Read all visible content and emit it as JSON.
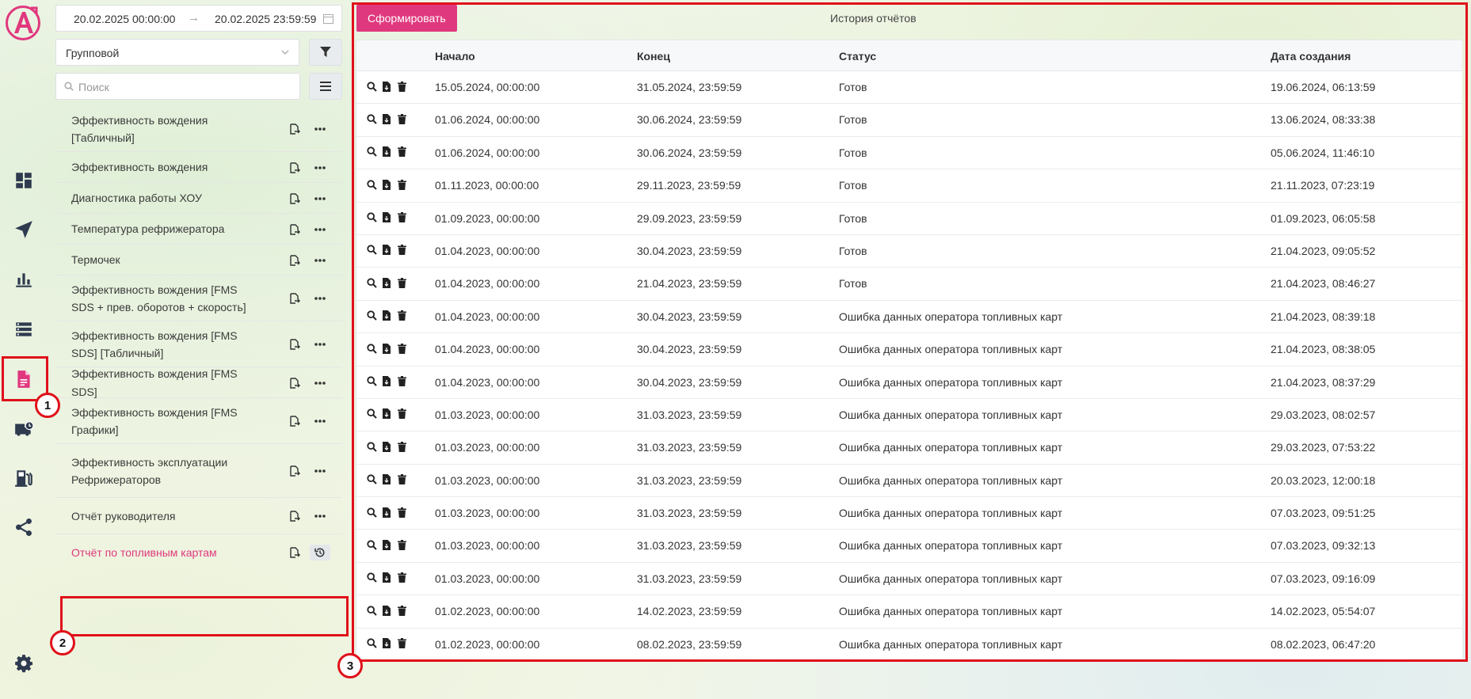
{
  "sidebar": {
    "date_start": "20.02.2025 00:00:00",
    "date_end": "20.02.2025 23:59:59",
    "report_type": "Групповой",
    "search_placeholder": "Поиск",
    "reports": [
      {
        "label": "Эффективность вождения [Табличный]"
      },
      {
        "label": "Эффективность вождения"
      },
      {
        "label": "Диагностика работы ХОУ"
      },
      {
        "label": "Температура рефрижератора"
      },
      {
        "label": "Термочек"
      },
      {
        "label": "Эффективность вождения [FMS SDS + прев. оборотов + скорость]"
      },
      {
        "label": "Эффективность вождения [FMS SDS] [Табличный]"
      },
      {
        "label": "Эффективность вождения [FMS SDS]"
      },
      {
        "label": "Эффективность вождения [FMS Графики]"
      },
      {
        "label": "Эффективность эксплуатации Рефрижераторов"
      },
      {
        "label": "Отчёт руководителя"
      },
      {
        "label": "Отчёт по топливным картам"
      }
    ]
  },
  "main": {
    "generate_label": "Сформировать",
    "title": "История отчётов",
    "columns": {
      "start": "Начало",
      "end": "Конец",
      "status": "Статус",
      "created": "Дата создания"
    },
    "rows": [
      {
        "start": "15.05.2024, 00:00:00",
        "end": "31.05.2024, 23:59:59",
        "status": "Готов",
        "created": "19.06.2024, 06:13:59"
      },
      {
        "start": "01.06.2024, 00:00:00",
        "end": "30.06.2024, 23:59:59",
        "status": "Готов",
        "created": "13.06.2024, 08:33:38"
      },
      {
        "start": "01.06.2024, 00:00:00",
        "end": "30.06.2024, 23:59:59",
        "status": "Готов",
        "created": "05.06.2024, 11:46:10"
      },
      {
        "start": "01.11.2023, 00:00:00",
        "end": "29.11.2023, 23:59:59",
        "status": "Готов",
        "created": "21.11.2023, 07:23:19"
      },
      {
        "start": "01.09.2023, 00:00:00",
        "end": "29.09.2023, 23:59:59",
        "status": "Готов",
        "created": "01.09.2023, 06:05:58"
      },
      {
        "start": "01.04.2023, 00:00:00",
        "end": "30.04.2023, 23:59:59",
        "status": "Готов",
        "created": "21.04.2023, 09:05:52"
      },
      {
        "start": "01.04.2023, 00:00:00",
        "end": "21.04.2023, 23:59:59",
        "status": "Готов",
        "created": "21.04.2023, 08:46:27"
      },
      {
        "start": "01.04.2023, 00:00:00",
        "end": "30.04.2023, 23:59:59",
        "status": "Ошибка данных оператора топливных карт",
        "created": "21.04.2023, 08:39:18"
      },
      {
        "start": "01.04.2023, 00:00:00",
        "end": "30.04.2023, 23:59:59",
        "status": "Ошибка данных оператора топливных карт",
        "created": "21.04.2023, 08:38:05"
      },
      {
        "start": "01.04.2023, 00:00:00",
        "end": "30.04.2023, 23:59:59",
        "status": "Ошибка данных оператора топливных карт",
        "created": "21.04.2023, 08:37:29"
      },
      {
        "start": "01.03.2023, 00:00:00",
        "end": "31.03.2023, 23:59:59",
        "status": "Ошибка данных оператора топливных карт",
        "created": "29.03.2023, 08:02:57"
      },
      {
        "start": "01.03.2023, 00:00:00",
        "end": "31.03.2023, 23:59:59",
        "status": "Ошибка данных оператора топливных карт",
        "created": "29.03.2023, 07:53:22"
      },
      {
        "start": "01.03.2023, 00:00:00",
        "end": "31.03.2023, 23:59:59",
        "status": "Ошибка данных оператора топливных карт",
        "created": "20.03.2023, 12:00:18"
      },
      {
        "start": "01.03.2023, 00:00:00",
        "end": "31.03.2023, 23:59:59",
        "status": "Ошибка данных оператора топливных карт",
        "created": "07.03.2023, 09:51:25"
      },
      {
        "start": "01.03.2023, 00:00:00",
        "end": "31.03.2023, 23:59:59",
        "status": "Ошибка данных оператора топливных карт",
        "created": "07.03.2023, 09:32:13"
      },
      {
        "start": "01.03.2023, 00:00:00",
        "end": "31.03.2023, 23:59:59",
        "status": "Ошибка данных оператора топливных карт",
        "created": "07.03.2023, 09:16:09"
      },
      {
        "start": "01.02.2023, 00:00:00",
        "end": "14.02.2023, 23:59:59",
        "status": "Ошибка данных оператора топливных карт",
        "created": "14.02.2023, 05:54:07"
      },
      {
        "start": "01.02.2023, 00:00:00",
        "end": "08.02.2023, 23:59:59",
        "status": "Ошибка данных оператора топливных карт",
        "created": "08.02.2023, 06:47:20"
      }
    ]
  },
  "annotations": [
    "1",
    "2",
    "3"
  ],
  "colors": {
    "accent": "#e0387e",
    "annotation": "#e0101a",
    "icon": "#2e3a4e"
  },
  "nav_icons": [
    "dashboard-icon",
    "navigation-arrow-icon",
    "bar-chart-icon",
    "list-icon",
    "report-document-icon",
    "truck-clock-icon",
    "fuel-station-icon",
    "share-icon",
    "gear-icon"
  ]
}
